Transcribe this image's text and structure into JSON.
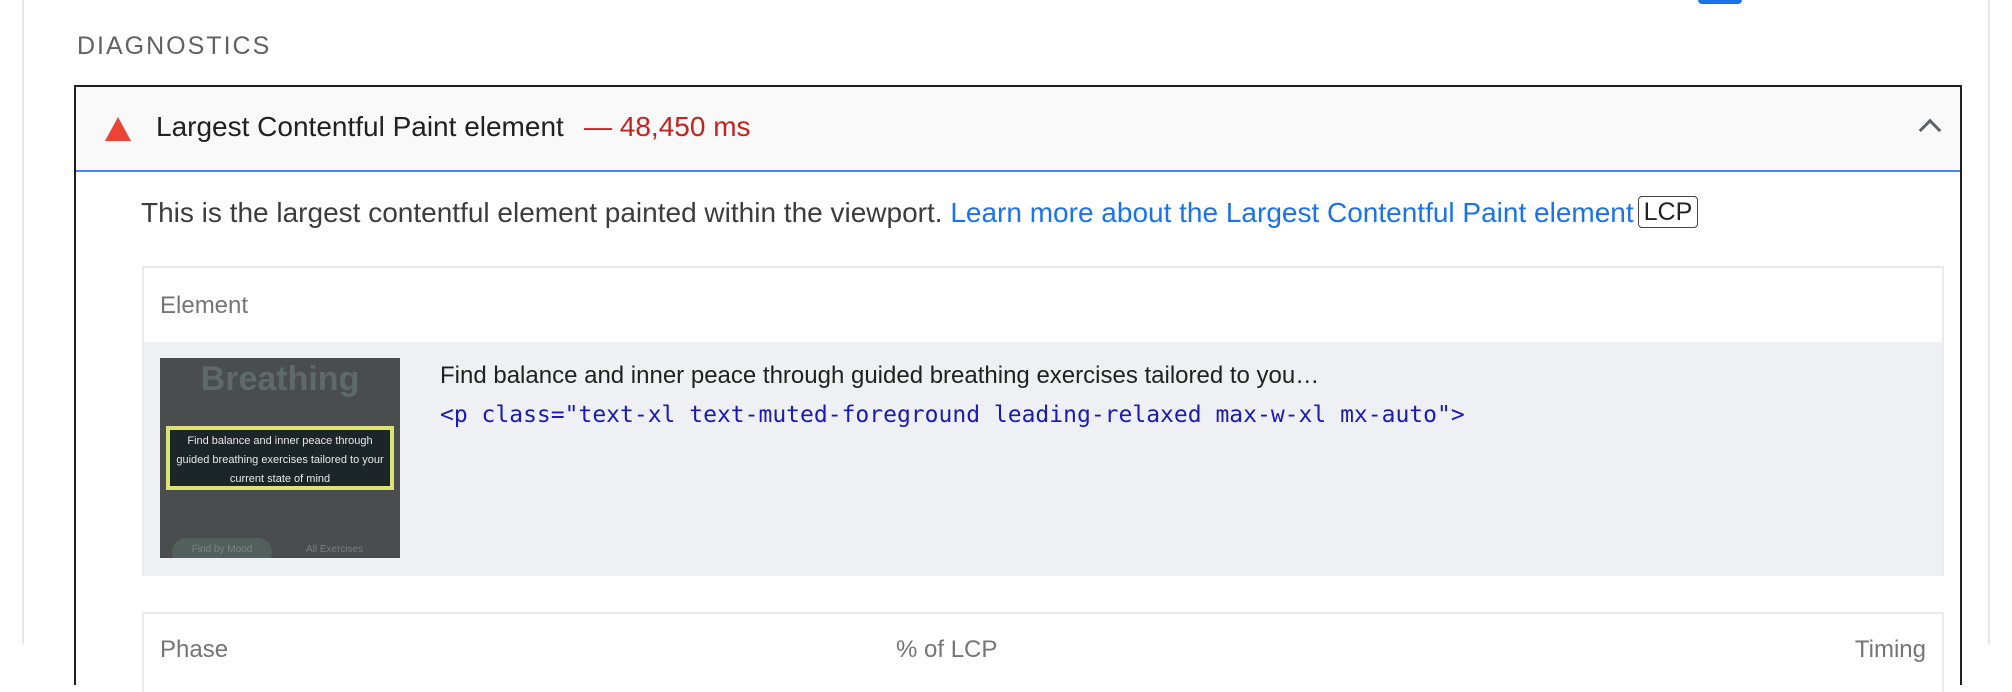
{
  "diagnostics": {
    "title": "DIAGNOSTICS"
  },
  "audit": {
    "title": "Largest Contentful Paint element",
    "value": "— 48,450 ms",
    "status_color": "#eb4335",
    "icon": "fail-triangle-icon",
    "expanded_icon": "chevron-up-icon",
    "description_text": "This is the largest contentful element painted within the viewport. ",
    "learn_more_link": "Learn more about the Largest Contentful Paint element",
    "badge": "LCP"
  },
  "element_table": {
    "header": "Element",
    "rows": [
      {
        "thumbnail": {
          "title": "Breathing",
          "highlight_text": "Find balance and inner peace through guided breathing exercises tailored to your current state of mind",
          "button_left": "Find by Mood",
          "button_right": "All Exercises"
        },
        "node_label": "Find balance and inner peace through guided breathing exercises tailored to you…",
        "snippet": "<p class=\"text-xl text-muted-foreground leading-relaxed max-w-xl mx-auto\">"
      }
    ]
  },
  "phase_table": {
    "headers": [
      "Phase",
      "% of LCP",
      "Timing"
    ]
  }
}
